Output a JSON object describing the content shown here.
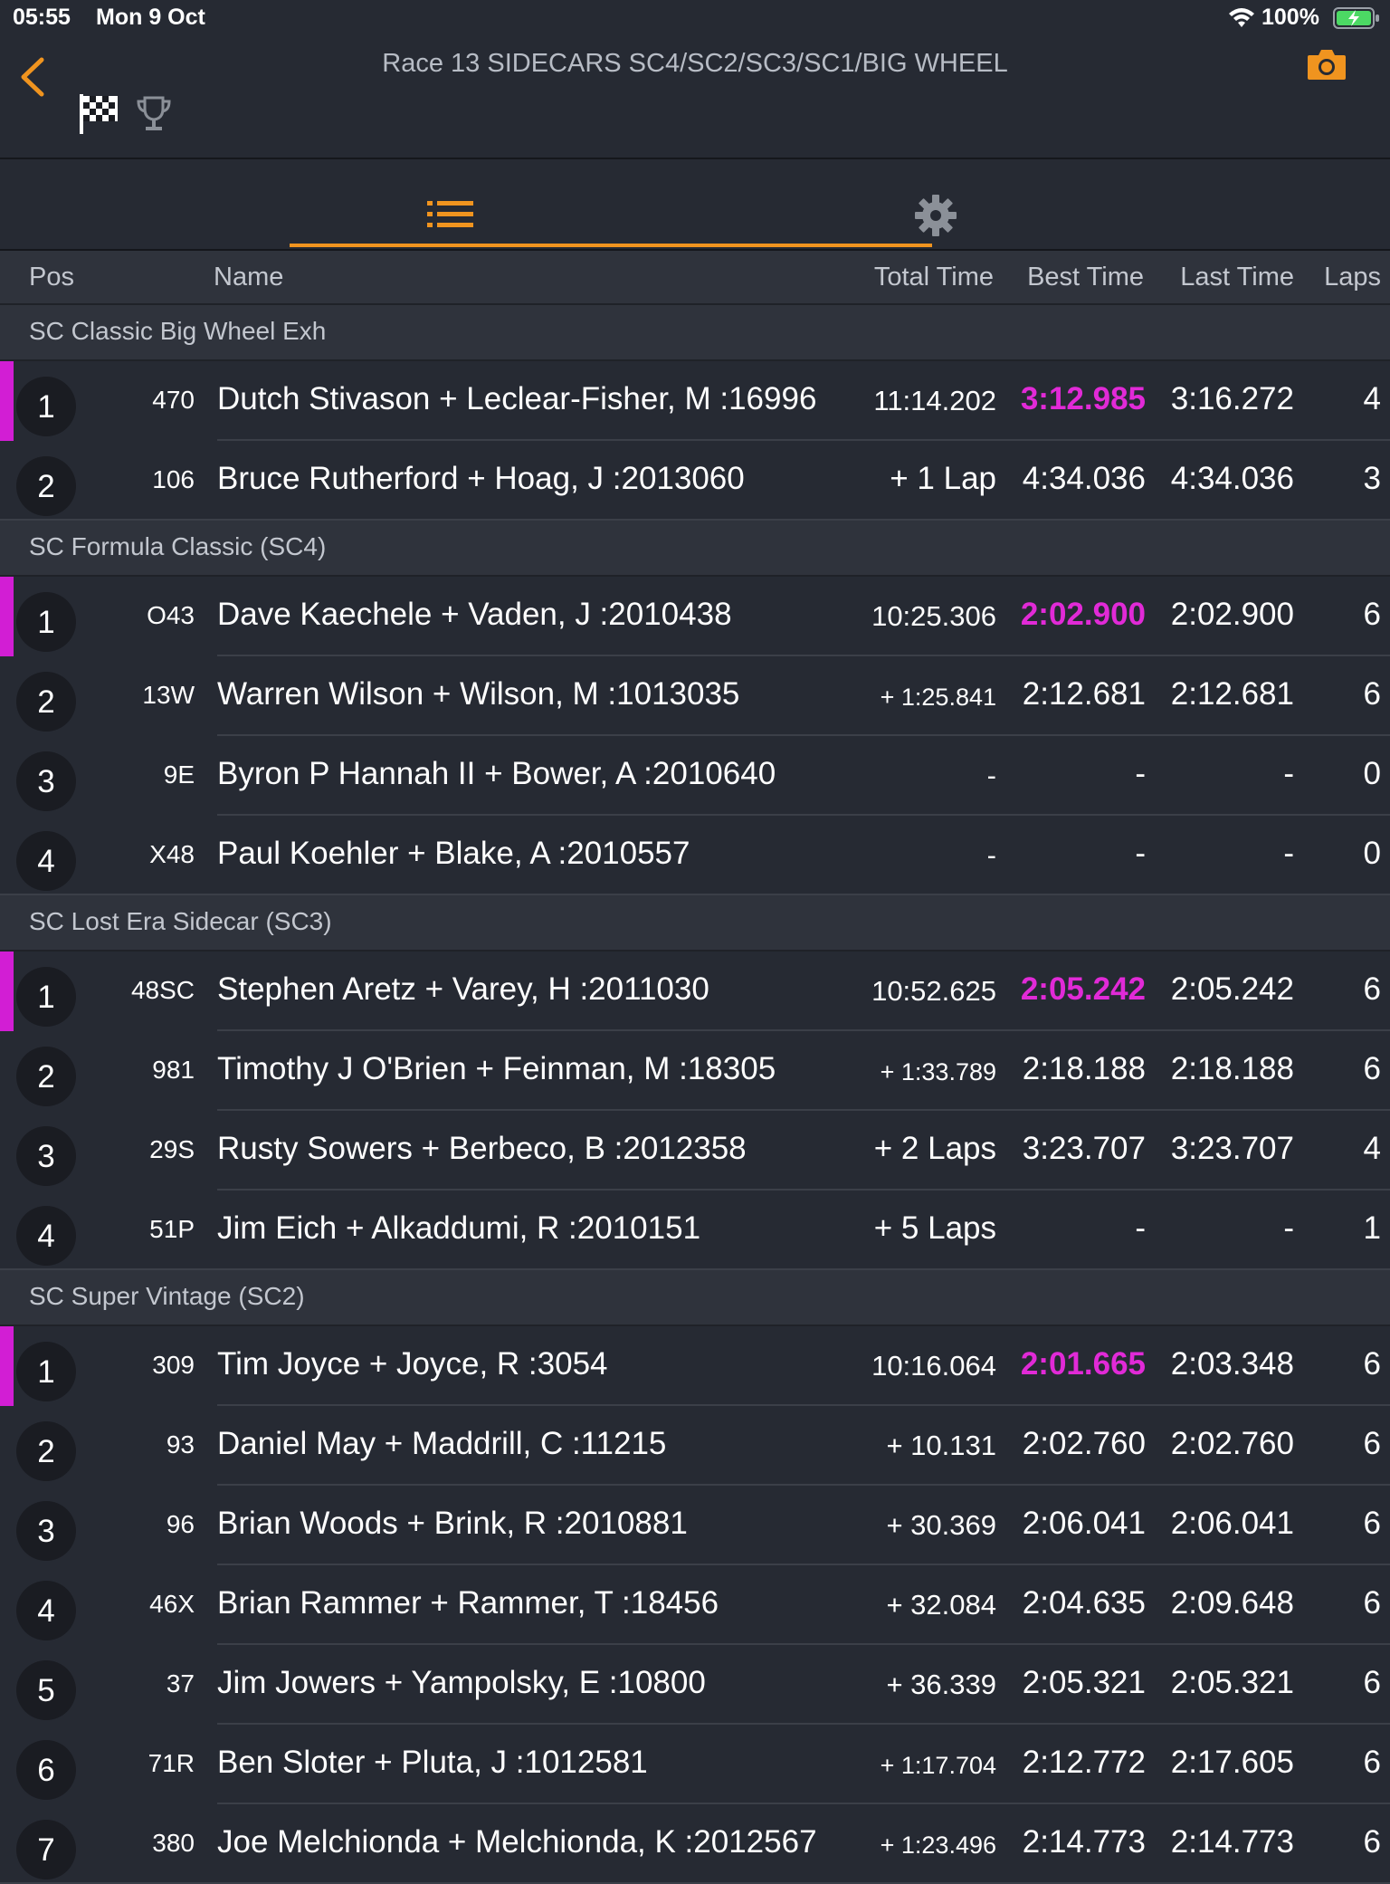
{
  "status_bar": {
    "time": "05:55",
    "date": "Mon 9 Oct",
    "battery": "100%"
  },
  "nav": {
    "title": "Race 13 SIDECARS SC4/SC2/SC3/SC1/BIG WHEEL",
    "accent_color": "#f0941f"
  },
  "columns": {
    "pos": "Pos",
    "name": "Name",
    "total_time": "Total Time",
    "best_time": "Best Time",
    "last_time": "Last Time",
    "laps": "Laps"
  },
  "colors": {
    "fastest_lap": "#e12ad7",
    "leader_bar": "#d21ed4"
  },
  "groups": [
    {
      "label": "SC Classic Big Wheel Exh",
      "rows": [
        {
          "pos": "1",
          "num": "470",
          "name": "Dutch Stivason + Leclear-Fisher, M :16996",
          "total": "11:14.202",
          "best": "3:12.985",
          "last": "3:16.272",
          "laps": "4",
          "leader": true
        },
        {
          "pos": "2",
          "num": "106",
          "name": "Bruce Rutherford + Hoag, J :2013060",
          "total": "+ 1 Lap",
          "best": "4:34.036",
          "last": "4:34.036",
          "laps": "3"
        }
      ]
    },
    {
      "label": "SC Formula Classic (SC4)",
      "rows": [
        {
          "pos": "1",
          "num": "O43",
          "name": "Dave Kaechele + Vaden, J :2010438",
          "total": "10:25.306",
          "best": "2:02.900",
          "last": "2:02.900",
          "laps": "6",
          "leader": true
        },
        {
          "pos": "2",
          "num": "13W",
          "name": "Warren Wilson + Wilson, M :1013035",
          "total": "+ 1:25.841",
          "best": "2:12.681",
          "last": "2:12.681",
          "laps": "6"
        },
        {
          "pos": "3",
          "num": "9E",
          "name": "Byron P Hannah II + Bower, A :2010640",
          "total": "-",
          "best": "-",
          "last": "-",
          "laps": "0"
        },
        {
          "pos": "4",
          "num": "X48",
          "name": "Paul Koehler + Blake, A :2010557",
          "total": "-",
          "best": "-",
          "last": "-",
          "laps": "0"
        }
      ]
    },
    {
      "label": "SC Lost Era Sidecar (SC3)",
      "rows": [
        {
          "pos": "1",
          "num": "48SC",
          "name": "Stephen Aretz + Varey, H :2011030",
          "total": "10:52.625",
          "best": "2:05.242",
          "last": "2:05.242",
          "laps": "6",
          "leader": true
        },
        {
          "pos": "2",
          "num": "981",
          "name": "Timothy J O'Brien + Feinman, M :18305",
          "total": "+ 1:33.789",
          "best": "2:18.188",
          "last": "2:18.188",
          "laps": "6"
        },
        {
          "pos": "3",
          "num": "29S",
          "name": "Rusty Sowers + Berbeco, B :2012358",
          "total": "+ 2 Laps",
          "best": "3:23.707",
          "last": "3:23.707",
          "laps": "4"
        },
        {
          "pos": "4",
          "num": "51P",
          "name": "Jim Eich + Alkaddumi, R :2010151",
          "total": "+ 5 Laps",
          "best": "-",
          "last": "-",
          "laps": "1"
        }
      ]
    },
    {
      "label": "SC Super Vintage (SC2)",
      "rows": [
        {
          "pos": "1",
          "num": "309",
          "name": "Tim Joyce + Joyce, R :3054",
          "total": "10:16.064",
          "best": "2:01.665",
          "last": "2:03.348",
          "laps": "6",
          "leader": true
        },
        {
          "pos": "2",
          "num": "93",
          "name": "Daniel May + Maddrill, C :11215",
          "total": "+ 10.131",
          "best": "2:02.760",
          "last": "2:02.760",
          "laps": "6"
        },
        {
          "pos": "3",
          "num": "96",
          "name": "Brian Woods + Brink, R :2010881",
          "total": "+ 30.369",
          "best": "2:06.041",
          "last": "2:06.041",
          "laps": "6"
        },
        {
          "pos": "4",
          "num": "46X",
          "name": "Brian Rammer + Rammer, T :18456",
          "total": "+ 32.084",
          "best": "2:04.635",
          "last": "2:09.648",
          "laps": "6"
        },
        {
          "pos": "5",
          "num": "37",
          "name": "Jim Jowers + Yampolsky, E :10800",
          "total": "+ 36.339",
          "best": "2:05.321",
          "last": "2:05.321",
          "laps": "6"
        },
        {
          "pos": "6",
          "num": "71R",
          "name": "Ben Sloter + Pluta, J :1012581",
          "total": "+ 1:17.704",
          "best": "2:12.772",
          "last": "2:17.605",
          "laps": "6"
        },
        {
          "pos": "7",
          "num": "380",
          "name": "Joe Melchionda + Melchionda, K :2012567",
          "total": "+ 1:23.496",
          "best": "2:14.773",
          "last": "2:14.773",
          "laps": "6"
        }
      ]
    }
  ]
}
